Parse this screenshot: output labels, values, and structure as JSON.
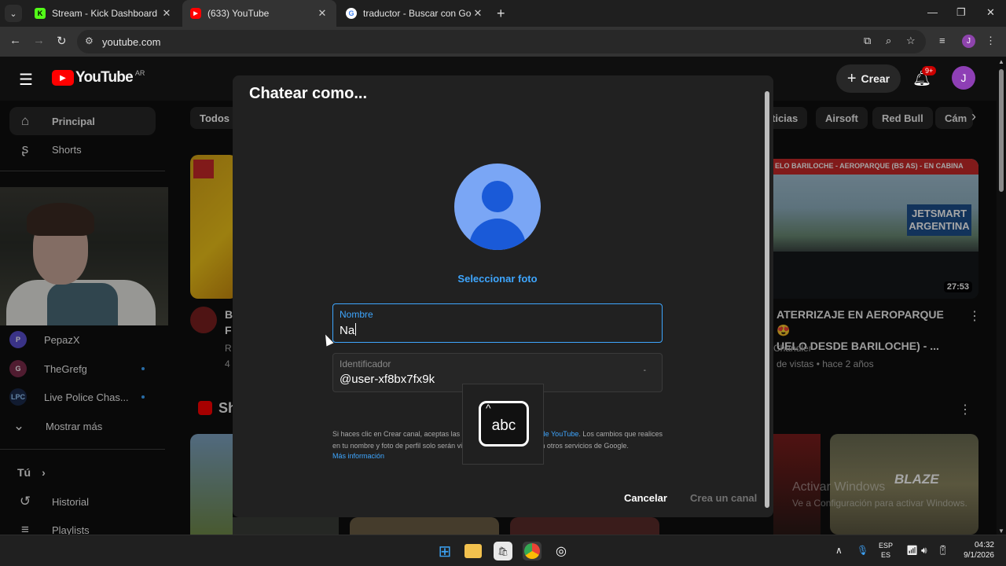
{
  "browser": {
    "tabs": [
      {
        "title": "Stream - Kick Dashboard",
        "active": false
      },
      {
        "title": "(633) YouTube",
        "active": true
      },
      {
        "title": "traductor - Buscar con Google",
        "active": false
      }
    ],
    "url": "youtube.com"
  },
  "youtube": {
    "logo_text": "YouTube",
    "country": "AR",
    "create_label": "Crear",
    "notif_badge": "9+",
    "avatar_letter": "J"
  },
  "sidebar": {
    "nav": [
      {
        "label": "Principal",
        "icon": "home-icon"
      },
      {
        "label": "Shorts",
        "icon": "shorts-icon"
      }
    ],
    "subscriptions": [
      {
        "label": "PepazX",
        "live": false
      },
      {
        "label": "TheGrefg",
        "live": true
      },
      {
        "label": "Live Police Chas...",
        "live": true
      }
    ],
    "show_more": "Mostrar más",
    "you_label": "Tú",
    "history_label": "Historial",
    "playlists_label": "Playlists"
  },
  "chips": [
    "Todos",
    "ticias",
    "Airsoft",
    "Red Bull",
    "Cám"
  ],
  "videos": {
    "right": {
      "title_line1": "ATERRIZAJE EN AEROPARQUE 😍",
      "title_line2": "UELO DESDE BARILOCHE) - ...",
      "channel": "Chandler",
      "meta": "de vistas • hace 2 años",
      "duration": "27:53",
      "thumb_banner": "ELO BARILOCHE - AEROPARQUE (BS AS) - EN CABINA",
      "thumb_brand": "JETSMART ARGENTINA"
    },
    "left": {
      "title_line1": "B",
      "title_line2": "F",
      "channel": "R",
      "meta": "4"
    },
    "shorts_label": "Sh",
    "blaze_text": "BLAZE"
  },
  "watermark": {
    "title": "Activar Windows",
    "subtitle": "Ve a Configuración para activar Windows."
  },
  "dialog": {
    "title": "Chatear como...",
    "select_photo": "Seleccionar foto",
    "name_label": "Nombre",
    "name_value": "Na",
    "handle_label": "Identificador",
    "handle_value": "@user-xf8bx7fx9k",
    "terms_prefix": "Si haces clic en Crear canal, aceptas las",
    "terms_link": "Condiciones del Servicio de YouTube",
    "terms_rest": ". Los cambios que realices en tu nombre y foto de perfil solo serán visibles en YouTube y no en otros servicios de Google.",
    "more_info": "Más información",
    "cancel": "Cancelar",
    "create": "Crea un canal"
  },
  "ime": {
    "key_text": "abc"
  },
  "taskbar": {
    "lang_line1": "ESP",
    "lang_line2": "ES",
    "time": "04:32",
    "date": "9/1/2026"
  },
  "colors": {
    "accent_blue": "#3ea6ff",
    "yt_red": "#ff0000",
    "dialog_bg": "#212121"
  }
}
